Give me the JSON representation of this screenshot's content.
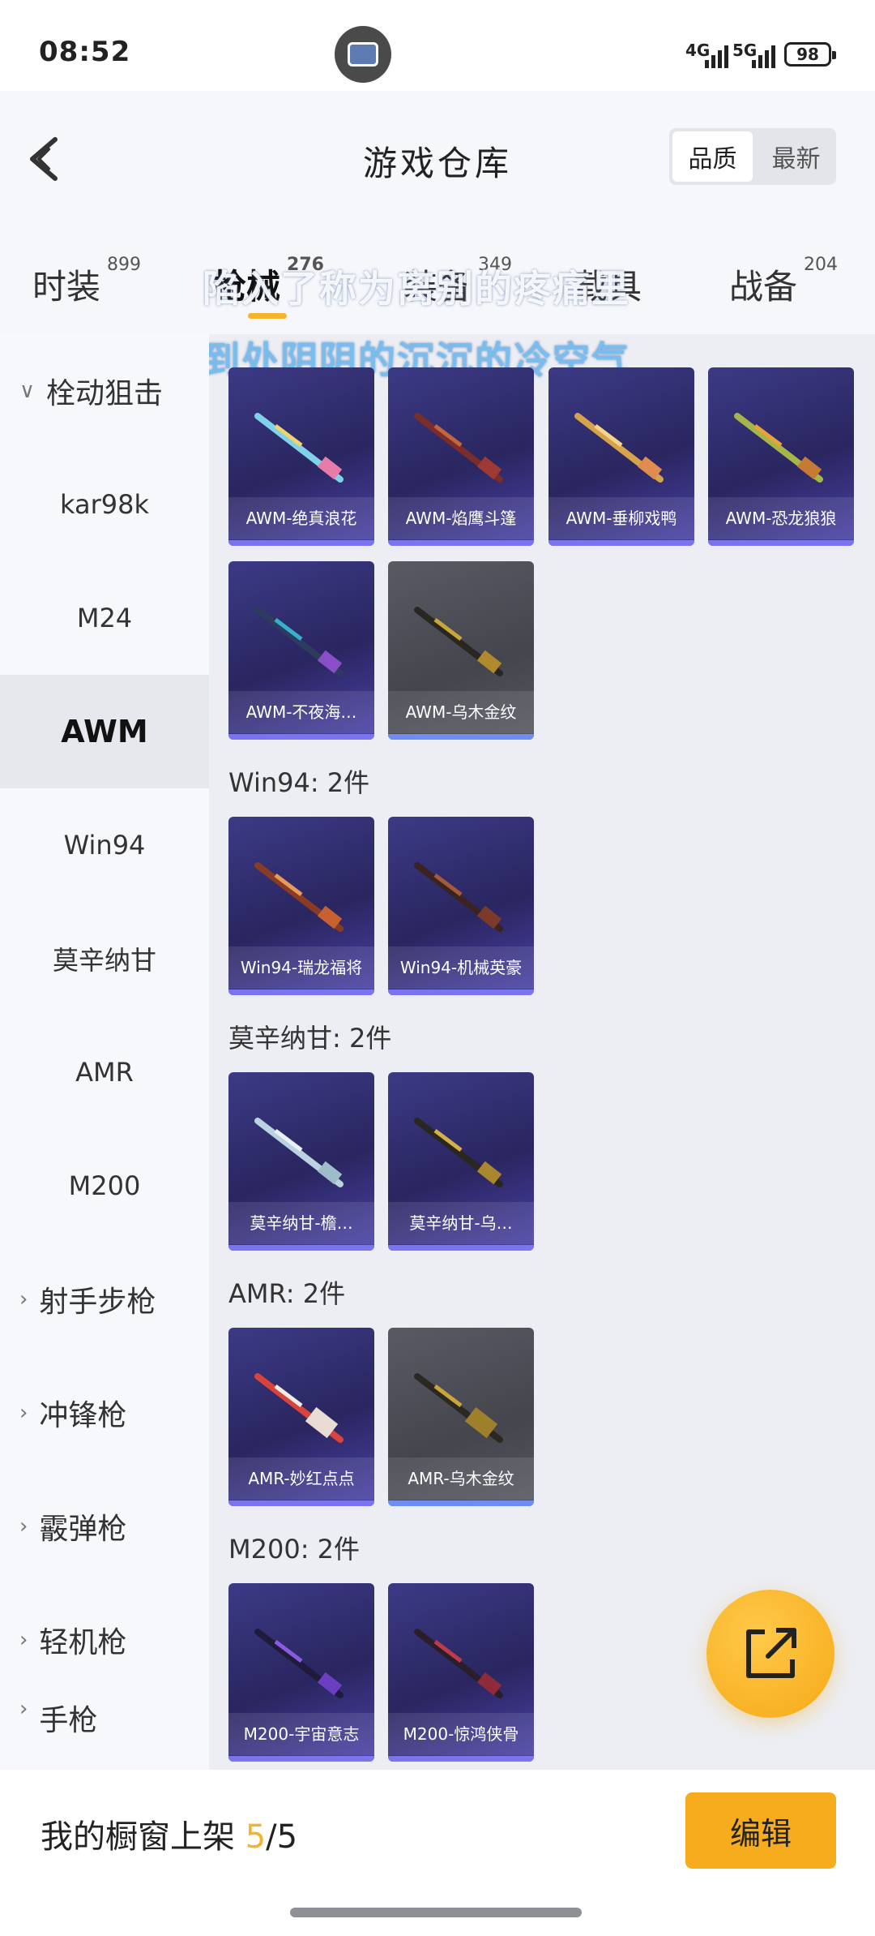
{
  "status_bar": {
    "time": "08:52",
    "net1": "4G",
    "net2": "5G",
    "battery": "98"
  },
  "header": {
    "title": "游戏仓库",
    "sort_options": [
      "品质",
      "最新"
    ],
    "active_sort": "品质"
  },
  "tabs": [
    {
      "label": "时装",
      "count": "899"
    },
    {
      "label": "枪械",
      "count": "276"
    },
    {
      "label": "装备",
      "count": "349"
    },
    {
      "label": "载具",
      "count": ""
    },
    {
      "label": "战备",
      "count": "204"
    }
  ],
  "overlay_caption": {
    "line1": "陷入了称为离别的疼痛里",
    "line2": "到处阴阴的沉沉的冷空气"
  },
  "sidebar": {
    "category_open": "栓动狙击",
    "items": [
      "kar98k",
      "M24",
      "AWM",
      "Win94",
      "莫辛纳甘",
      "AMR",
      "M200"
    ],
    "active_item": "AWM",
    "categories": [
      "射手步枪",
      "冲锋枪",
      "霰弹枪",
      "轻机枪",
      "手枪"
    ]
  },
  "sections": {
    "awm": {
      "items": [
        "AWM-绝真浪花",
        "AWM-焰鹰斗篷",
        "AWM-垂柳戏鸭",
        "AWM-恐龙狼狼",
        "AWM-不夜海…",
        "AWM-乌木金纹"
      ]
    },
    "win94": {
      "label": "Win94: 2件",
      "items": [
        "Win94-瑞龙福将",
        "Win94-机械英豪"
      ]
    },
    "mosin": {
      "label": "莫辛纳甘: 2件",
      "items": [
        "莫辛纳甘-檐…",
        "莫辛纳甘-乌…"
      ]
    },
    "amr": {
      "label": "AMR: 2件",
      "items": [
        "AMR-妙红点点",
        "AMR-乌木金纹"
      ]
    },
    "m200": {
      "label": "M200: 2件",
      "items": [
        "M200-宇宙意志",
        "M200-惊鸿侠骨"
      ]
    }
  },
  "bottom": {
    "shelf_label": "我的橱窗上架",
    "shelf_current": "5",
    "shelf_total": "/5",
    "edit_label": "编辑"
  },
  "colors": {
    "accent": "#f7ac1e",
    "card_purple": "#2a2660",
    "card_gray": "#45454e"
  }
}
